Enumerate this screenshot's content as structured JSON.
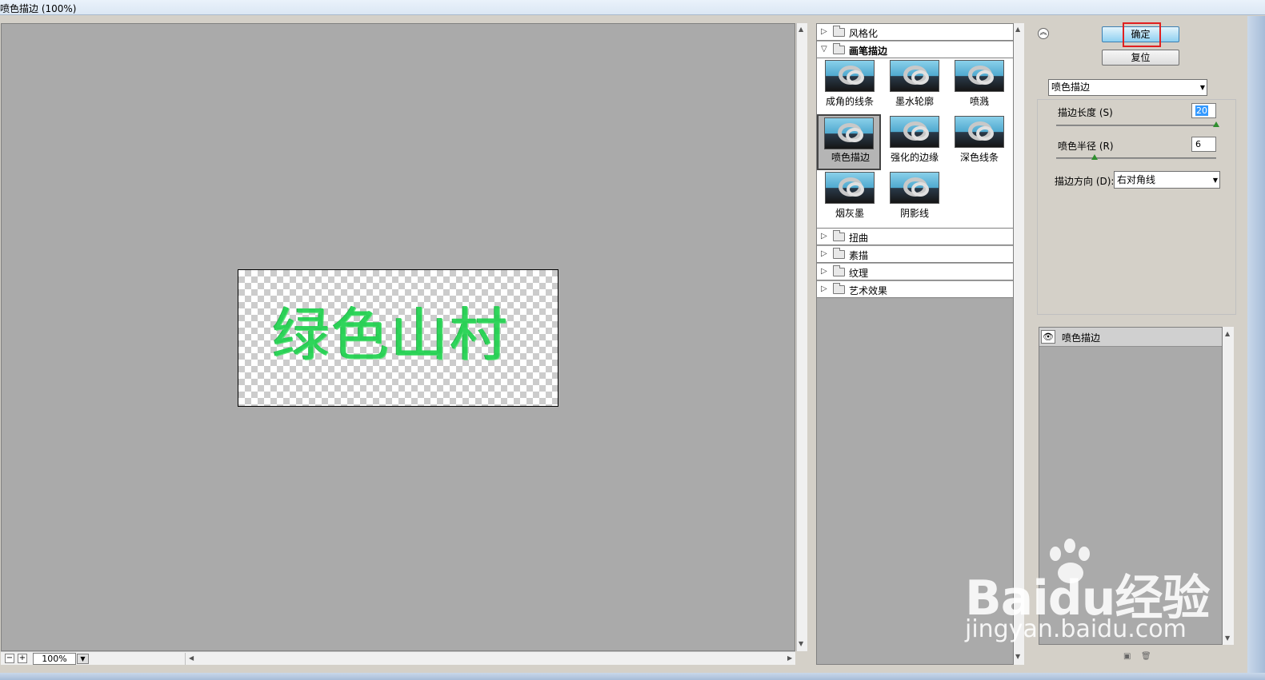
{
  "window": {
    "title": "喷色描边 (100%)"
  },
  "preview": {
    "artwork_text": "绿色山村",
    "zoom": "100%",
    "zoom_out_label": "−",
    "zoom_in_label": "+"
  },
  "gallery": {
    "categories_top": [
      {
        "label": "风格化",
        "expanded": false
      }
    ],
    "open_category": {
      "label": "画笔描边",
      "expanded": true
    },
    "filters": [
      {
        "label": "成角的线条"
      },
      {
        "label": "墨水轮廓"
      },
      {
        "label": "喷溅"
      },
      {
        "label": "喷色描边",
        "selected": true
      },
      {
        "label": "强化的边缘"
      },
      {
        "label": "深色线条"
      },
      {
        "label": "烟灰墨"
      },
      {
        "label": "阴影线"
      }
    ],
    "categories_bottom": [
      {
        "label": "扭曲"
      },
      {
        "label": "素描"
      },
      {
        "label": "纹理"
      },
      {
        "label": "艺术效果"
      }
    ]
  },
  "controls": {
    "ok_label": "确定",
    "reset_label": "复位",
    "filter_select": "喷色描边",
    "stroke_length_label": "描边长度 (S)",
    "stroke_length_value": "20",
    "stroke_length_fraction": 1.0,
    "spray_radius_label": "喷色半径 (R)",
    "spray_radius_value": "6",
    "spray_radius_fraction": 0.24,
    "stroke_dir_label": "描边方向 (D):",
    "stroke_dir_value": "右对角线"
  },
  "layers": {
    "items": [
      {
        "label": "喷色描边",
        "visible": true
      }
    ]
  },
  "watermark": {
    "brand_text": "Baidu经验",
    "url_text": "jingyan.baidu.com"
  },
  "colors": {
    "artwork_green": "#19d14a",
    "ok_button_blue": "#8fd0f1",
    "highlight_red": "#e02020"
  }
}
